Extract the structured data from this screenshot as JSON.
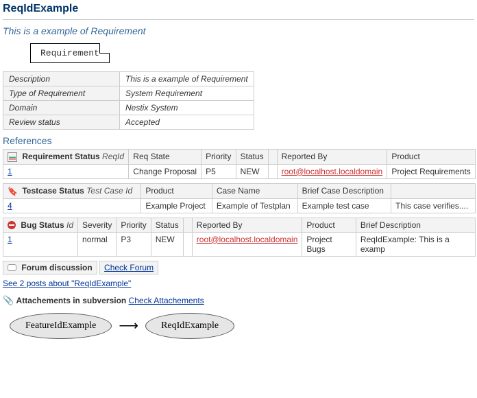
{
  "title": "ReqIdExample",
  "subtitle": "This is a example of Requirement",
  "req_box_label": "Requirement",
  "details": {
    "rows": [
      {
        "k": "Description",
        "v": "This is a example of Requirement"
      },
      {
        "k": "Type of Requirement",
        "v": "System Requirement"
      },
      {
        "k": "Domain",
        "v": "Nestix System"
      },
      {
        "k": "Review status",
        "v": "Accepted"
      }
    ]
  },
  "references_heading": "References",
  "req_status": {
    "title": "Requirement Status",
    "id_col": "ReqId",
    "headers": [
      "Req State",
      "Priority",
      "Status",
      "Reported By",
      "Product"
    ],
    "row": {
      "id": "1",
      "state": "Change Proposal",
      "priority": "P5",
      "status": "NEW",
      "reported_by": "root@localhost.localdomain",
      "product": "Project Requirements"
    }
  },
  "testcase_status": {
    "title": "Testcase Status",
    "id_col": "Test Case Id",
    "headers": [
      "Product",
      "Case Name",
      "Brief Case Description",
      ""
    ],
    "row": {
      "id": "4",
      "product": "Example Project",
      "case_name": "Example of Testplan",
      "brief": "Example test case",
      "extra": "This case verifies...."
    }
  },
  "bug_status": {
    "title": "Bug Status",
    "id_col": "Id",
    "headers": [
      "Severity",
      "Priority",
      "Status",
      "Reported By",
      "Product",
      "Brief Description"
    ],
    "row": {
      "id": "1",
      "severity": "normal",
      "priority": "P3",
      "status": "NEW",
      "reported_by": "root@localhost.localdomain",
      "product": "Project Bugs",
      "brief": "ReqIdExample: This is a examp"
    }
  },
  "forum": {
    "title": "Forum discussion",
    "check_link": "Check Forum",
    "posts_link": "See 2 posts about \"ReqIdExample\""
  },
  "attachments": {
    "title": "Attachements in subversion",
    "check_link": "Check Attachements"
  },
  "diagram": {
    "from": "FeatureIdExample",
    "to": "ReqIdExample"
  }
}
